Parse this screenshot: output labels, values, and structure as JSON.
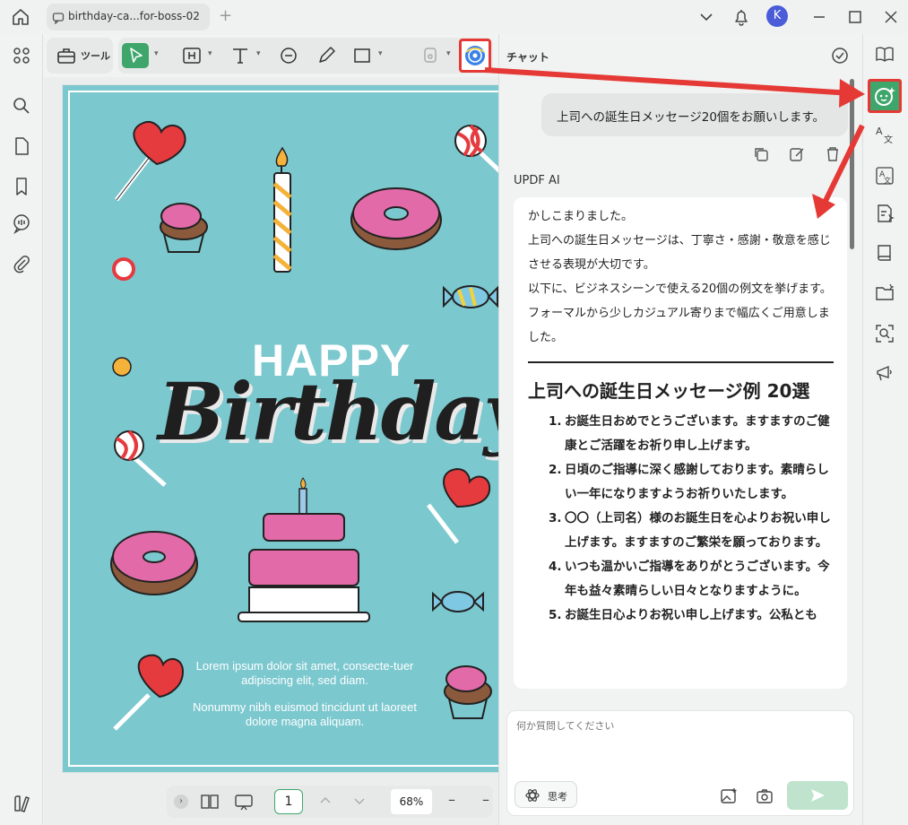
{
  "tab": {
    "title": "birthday-ca...for-boss-02"
  },
  "avatar": {
    "initial": "K"
  },
  "toolbar": {
    "tool_label": "ツール"
  },
  "document": {
    "headline_top": "HAPPY",
    "headline_main": "Birthday",
    "lorem_1": "Lorem ipsum dolor sit amet, consecte-tuer adipiscing elit, sed diam.",
    "lorem_2": "Nonummy nibh euismod tincidunt ut laoreet dolore magna aliquam.",
    "colors": {
      "background": "#7cc8cf",
      "donut": "#e26aa8",
      "heart": "#e53a3e"
    }
  },
  "pager": {
    "page": "1",
    "zoom": "68%"
  },
  "chat": {
    "title": "チャット",
    "user_message": "上司への誕生日メッセージ20個をお願いします。",
    "ai_name": "UPDF AI",
    "ai_lines": [
      "かしこまりました。",
      "上司への誕生日メッセージは、丁寧さ・感謝・敬意を感じさせる表現が大切です。",
      "以下に、ビジネスシーンで使える20個の例文を挙げます。フォーマルから少しカジュアル寄りまで幅広くご用意しました。"
    ],
    "heading": "上司への誕生日メッセージ例 20選",
    "items": [
      {
        "num": "1.",
        "text": "お誕生日おめでとうございます。ますますのご健康とご活躍をお祈り申し上げます。"
      },
      {
        "num": "2.",
        "text": "日頃のご指導に深く感謝しております。素晴らしい一年になりますようお祈りいたします。"
      },
      {
        "num": "3.",
        "text": "〇〇（上司名）様のお誕生日を心よりお祝い申し上げます。ますますのご繁栄を願っております。"
      },
      {
        "num": "4.",
        "text": "いつも温かいご指導をありがとうございます。今年も益々素晴らしい日々となりますように。"
      },
      {
        "num": "5.",
        "text": "お誕生日心よりお祝い申し上げます。公私とも"
      }
    ],
    "input_placeholder": "何か質問してください",
    "think_label": "思考"
  },
  "accent": "#3fa66b",
  "highlight": "#e53935"
}
